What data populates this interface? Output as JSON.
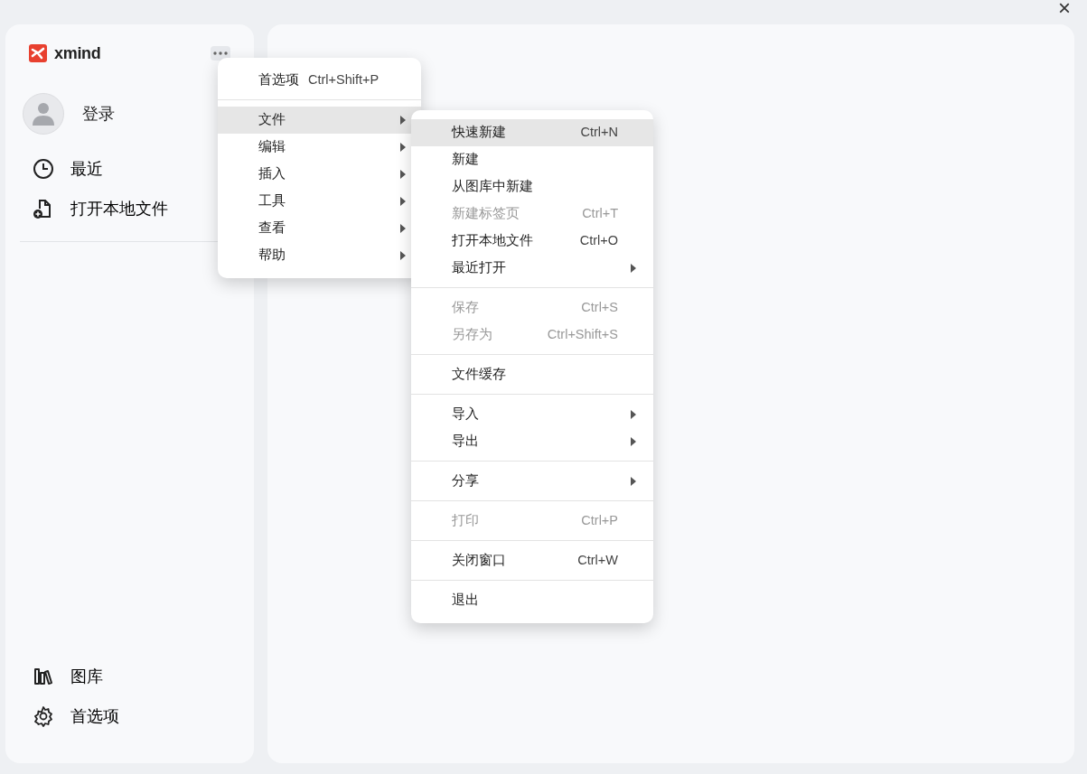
{
  "window": {
    "close": "×"
  },
  "sidebar": {
    "logo": "xmind",
    "login": "登录",
    "nav": [
      {
        "label": "最近"
      },
      {
        "label": "打开本地文件"
      }
    ],
    "bottom": [
      {
        "label": "图库"
      },
      {
        "label": "首选项"
      }
    ]
  },
  "menu": {
    "groups": [
      [
        {
          "label": "首选项",
          "shortcut": "Ctrl+Shift+P",
          "submenu": false,
          "selected": false
        }
      ],
      [
        {
          "label": "文件",
          "submenu": true,
          "selected": true
        },
        {
          "label": "编辑",
          "submenu": true,
          "selected": false
        },
        {
          "label": "插入",
          "submenu": true,
          "selected": false
        },
        {
          "label": "工具",
          "submenu": true,
          "selected": false
        },
        {
          "label": "查看",
          "submenu": true,
          "selected": false
        },
        {
          "label": "帮助",
          "submenu": true,
          "selected": false
        }
      ]
    ]
  },
  "submenu": {
    "groups": [
      [
        {
          "label": "快速新建",
          "shortcut": "Ctrl+N",
          "submenu": false,
          "disabled": false,
          "selected": true
        },
        {
          "label": "新建",
          "submenu": false,
          "disabled": false,
          "selected": false
        },
        {
          "label": "从图库中新建",
          "submenu": false,
          "disabled": false,
          "selected": false
        },
        {
          "label": "新建标签页",
          "shortcut": "Ctrl+T",
          "submenu": false,
          "disabled": true,
          "selected": false
        },
        {
          "label": "打开本地文件",
          "shortcut": "Ctrl+O",
          "submenu": false,
          "disabled": false,
          "selected": false
        },
        {
          "label": "最近打开",
          "submenu": true,
          "disabled": false,
          "selected": false
        }
      ],
      [
        {
          "label": "保存",
          "shortcut": "Ctrl+S",
          "submenu": false,
          "disabled": true,
          "selected": false
        },
        {
          "label": "另存为",
          "shortcut": "Ctrl+Shift+S",
          "submenu": false,
          "disabled": true,
          "selected": false
        }
      ],
      [
        {
          "label": "文件缓存",
          "submenu": false,
          "disabled": false,
          "selected": false
        }
      ],
      [
        {
          "label": "导入",
          "submenu": true,
          "disabled": false,
          "selected": false
        },
        {
          "label": "导出",
          "submenu": true,
          "disabled": false,
          "selected": false
        }
      ],
      [
        {
          "label": "分享",
          "submenu": true,
          "disabled": false,
          "selected": false
        }
      ],
      [
        {
          "label": "打印",
          "shortcut": "Ctrl+P",
          "submenu": false,
          "disabled": true,
          "selected": false
        }
      ],
      [
        {
          "label": "关闭窗口",
          "shortcut": "Ctrl+W",
          "submenu": false,
          "disabled": false,
          "selected": false
        }
      ],
      [
        {
          "label": "退出",
          "submenu": false,
          "disabled": false,
          "selected": false
        }
      ]
    ]
  }
}
